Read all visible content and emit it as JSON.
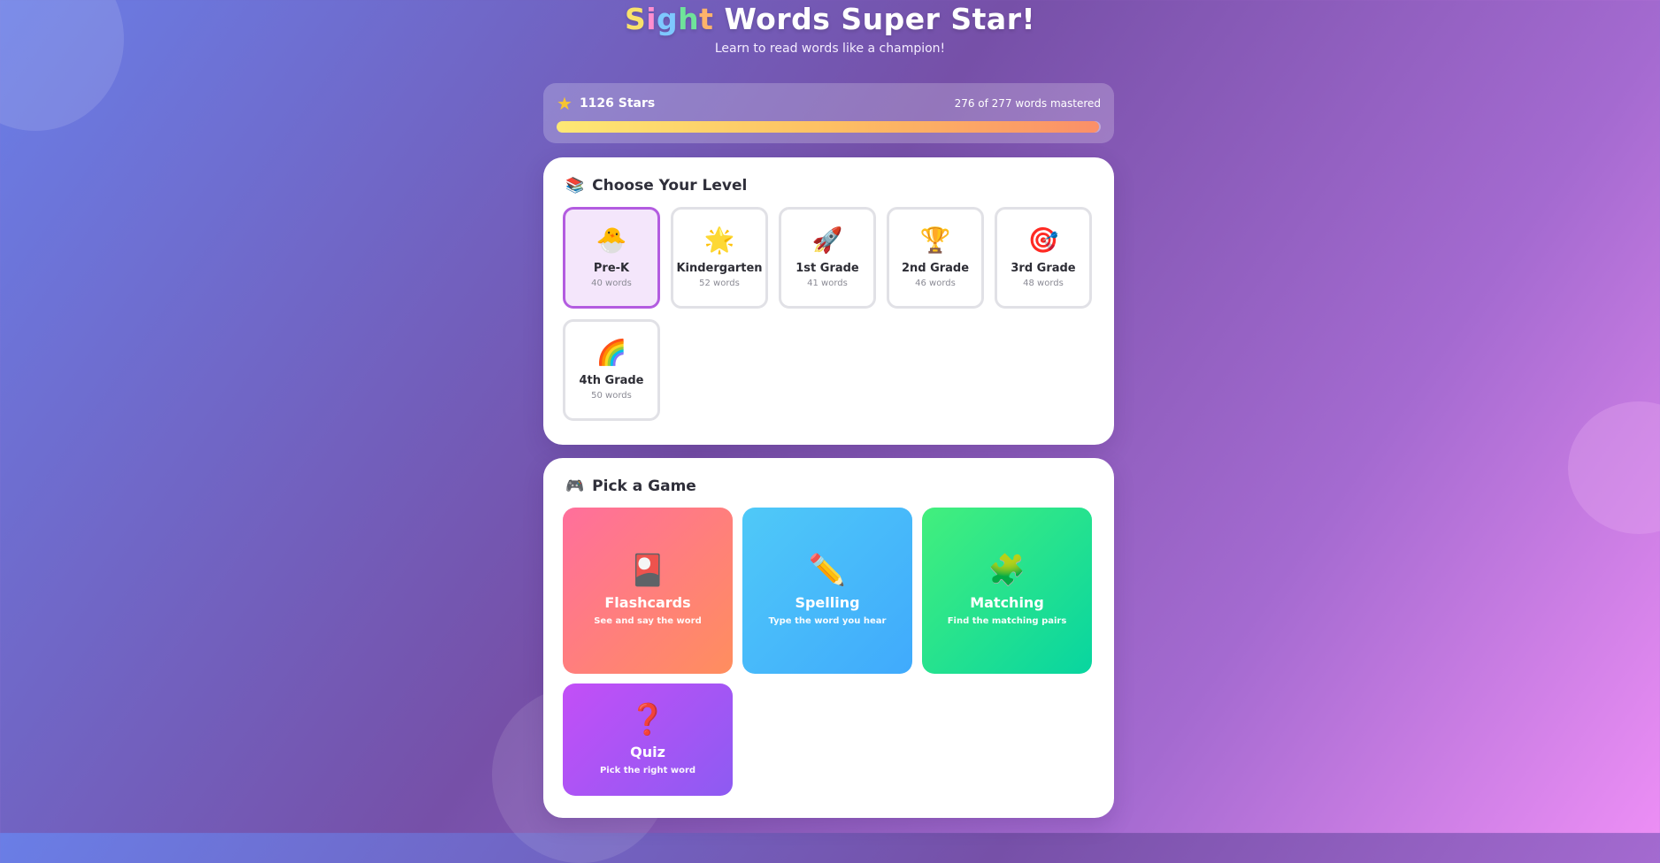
{
  "header": {
    "title_letters": [
      "S",
      "i",
      "g",
      "h",
      "t"
    ],
    "title_rest": " Words Super Star!",
    "subtitle": "Learn to read words like a champion!"
  },
  "stars": {
    "icon": "star-icon",
    "label": "1126 Stars",
    "mastered_text": "276 of 277 words mastered",
    "mastered_count": 276,
    "total_words": 277,
    "progress_fraction": 0.996
  },
  "levels_section": {
    "icon": "books-icon",
    "title": "Choose Your Level",
    "items": [
      {
        "icon": "hatching-chick-icon",
        "glyph": "🐣",
        "name": "Pre-K",
        "count": "40 words",
        "selected": true
      },
      {
        "icon": "glowing-star-icon",
        "glyph": "🌟",
        "name": "Kindergarten",
        "count": "52 words",
        "selected": false
      },
      {
        "icon": "rocket-icon",
        "glyph": "🚀",
        "name": "1st Grade",
        "count": "41 words",
        "selected": false
      },
      {
        "icon": "trophy-icon",
        "glyph": "🏆",
        "name": "2nd Grade",
        "count": "46 words",
        "selected": false
      },
      {
        "icon": "target-icon",
        "glyph": "🎯",
        "name": "3rd Grade",
        "count": "48 words",
        "selected": false
      },
      {
        "icon": "rainbow-icon",
        "glyph": "🌈",
        "name": "4th Grade",
        "count": "50 words",
        "selected": false
      }
    ]
  },
  "games_section": {
    "icon": "game-controller-icon",
    "title": "Pick a Game",
    "items": [
      {
        "icon": "flashcard-icon",
        "glyph": "🎴",
        "name": "Flashcards",
        "desc": "See and say the word"
      },
      {
        "icon": "pencil-icon",
        "glyph": "✏️",
        "name": "Spelling",
        "desc": "Type the word you hear"
      },
      {
        "icon": "puzzle-icon",
        "glyph": "🧩",
        "name": "Matching",
        "desc": "Find the matching pairs"
      },
      {
        "icon": "question-mark-icon",
        "glyph": "❓",
        "name": "Quiz",
        "desc": "Pick the right word"
      }
    ]
  },
  "colors": {
    "selected_border": "#b35ce0",
    "selected_bg": "#f4e6fb",
    "flashcards": [
      "#ff6f9c",
      "#ff8e5e"
    ],
    "spelling": [
      "#4fc9f8",
      "#40aafc"
    ],
    "matching": [
      "#43ef7d",
      "#08d5a0"
    ],
    "quiz": [
      "#c34ff7",
      "#8d5bf2"
    ]
  }
}
